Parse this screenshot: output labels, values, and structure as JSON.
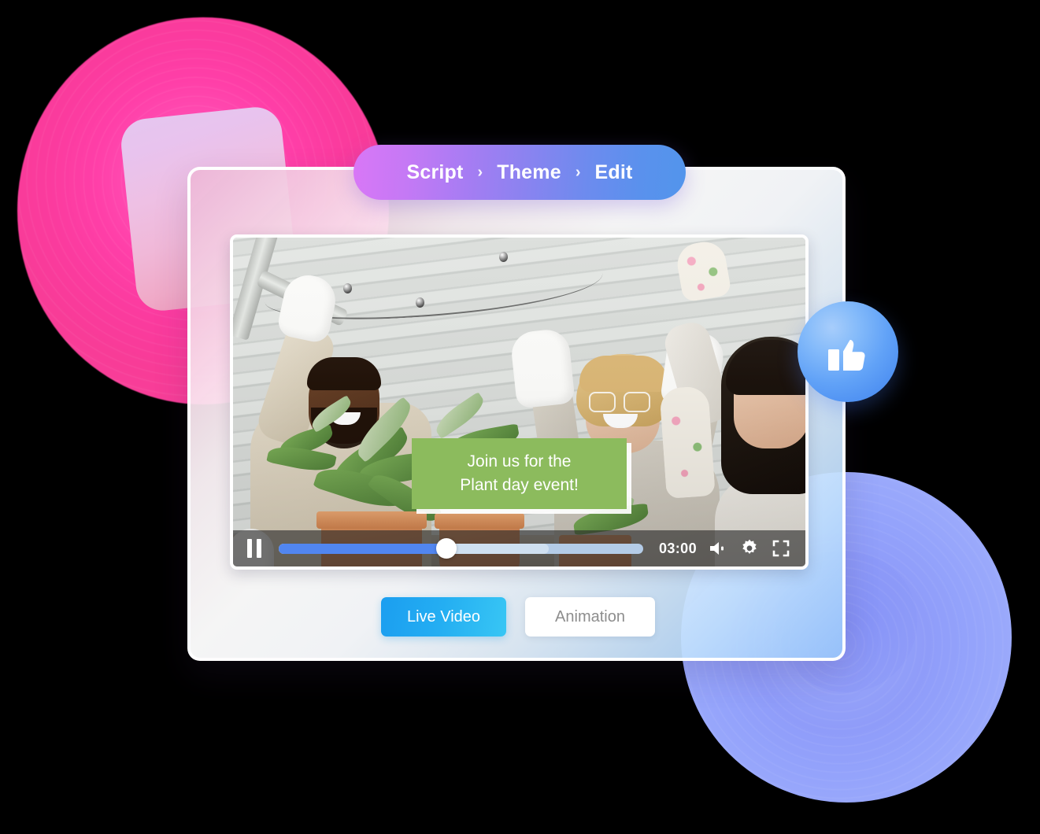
{
  "breadcrumb": {
    "items": [
      "Script",
      "Theme",
      "Edit"
    ],
    "separator": "›"
  },
  "player": {
    "caption_line1": "Join us for the",
    "caption_line2": "Plant day event!",
    "caption_bg": "#8cbb5d",
    "time": "03:00",
    "progress_percent": 46,
    "buffered_percent": 74,
    "pause_label": "Pause",
    "volume_label": "Volume",
    "settings_label": "Settings",
    "fullscreen_label": "Fullscreen",
    "progress_fill_color": "#5186f0"
  },
  "modes": {
    "live_label": "Live Video",
    "animation_label": "Animation",
    "active": "Live Video",
    "active_color": "#24aef2"
  },
  "badge": {
    "icon": "thumbs-up-icon",
    "color": "#5ea0f7"
  },
  "scene": {
    "description": "Three people in gardening gloves high-fiving behind potted plants"
  }
}
